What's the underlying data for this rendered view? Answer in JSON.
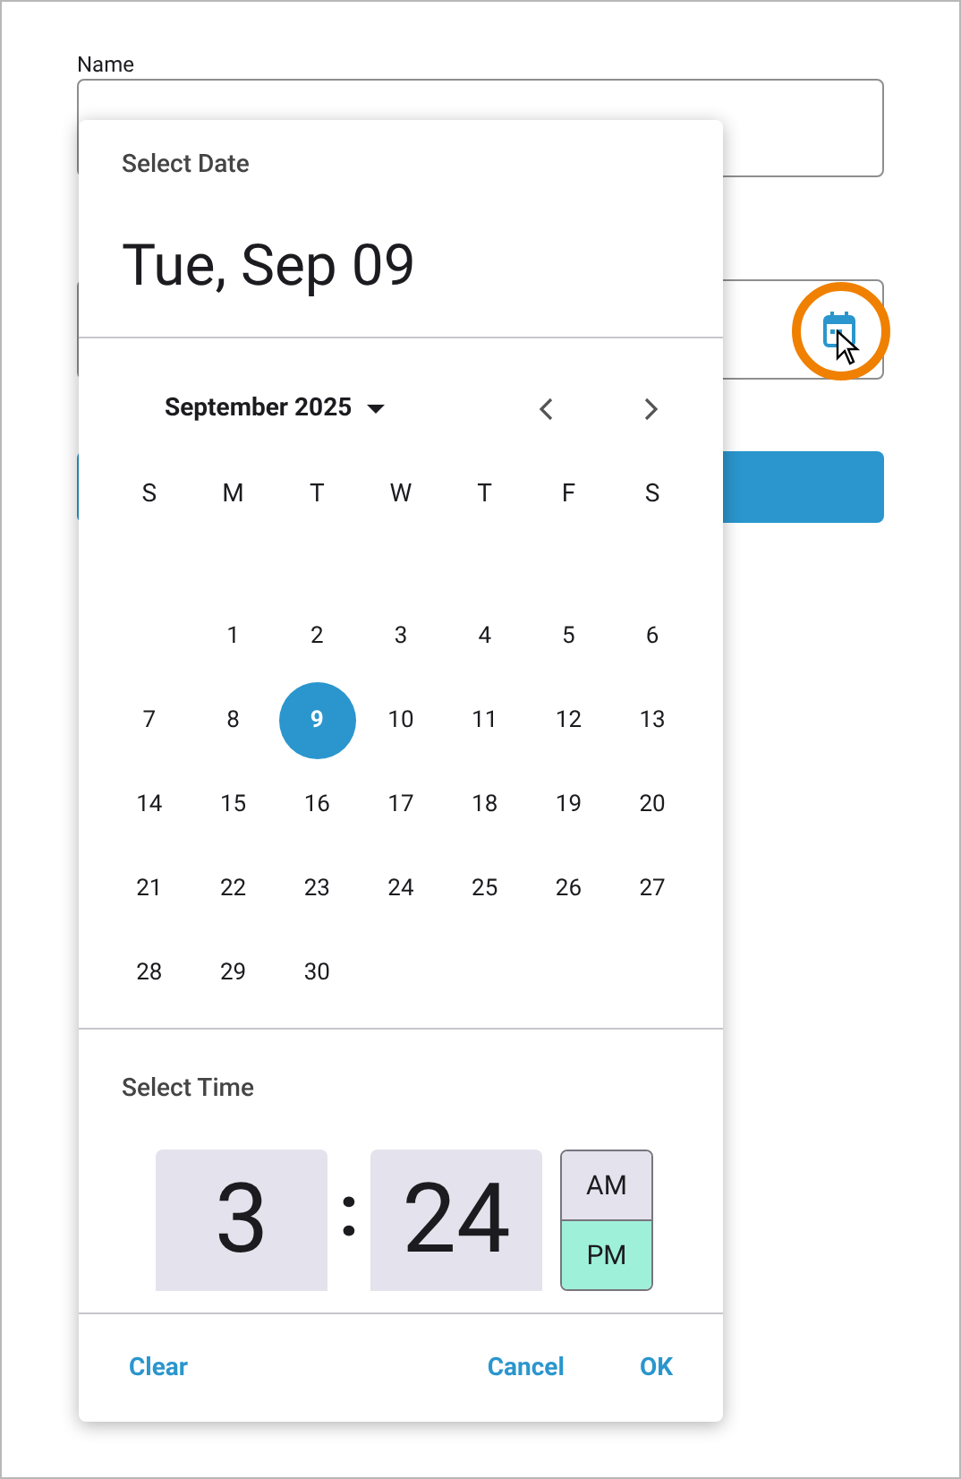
{
  "form": {
    "name_label": "Name",
    "submit_button": {
      "kind": "button"
    }
  },
  "date_picker": {
    "title": "Select Date",
    "selected_date": "Tue, Sep 09",
    "month_label": "September 2025",
    "weekdays": [
      "S",
      "M",
      "T",
      "W",
      "T",
      "F",
      "S"
    ],
    "weeks": [
      {
        "kind": "partial",
        "days": [
          {
            "day": "1",
            "selected": false
          },
          {
            "day": "2",
            "selected": false
          },
          {
            "day": "3",
            "selected": false
          },
          {
            "day": "4",
            "selected": false
          },
          {
            "day": "5",
            "selected": false
          },
          {
            "day": "6",
            "selected": false
          }
        ]
      },
      {
        "kind": "full",
        "days": [
          {
            "day": "7",
            "selected": false
          },
          {
            "day": "8",
            "selected": false
          },
          {
            "day": "9",
            "selected": true
          },
          {
            "day": "10",
            "selected": false
          },
          {
            "day": "11",
            "selected": false
          },
          {
            "day": "12",
            "selected": false
          },
          {
            "day": "13",
            "selected": false
          }
        ]
      },
      {
        "kind": "full",
        "days": [
          {
            "day": "14",
            "selected": false
          },
          {
            "day": "15",
            "selected": false
          },
          {
            "day": "16",
            "selected": false
          },
          {
            "day": "17",
            "selected": false
          },
          {
            "day": "18",
            "selected": false
          },
          {
            "day": "19",
            "selected": false
          },
          {
            "day": "20",
            "selected": false
          }
        ]
      },
      {
        "kind": "full",
        "days": [
          {
            "day": "21",
            "selected": false
          },
          {
            "day": "22",
            "selected": false
          },
          {
            "day": "23",
            "selected": false
          },
          {
            "day": "24",
            "selected": false
          },
          {
            "day": "25",
            "selected": false
          },
          {
            "day": "26",
            "selected": false
          },
          {
            "day": "27",
            "selected": false
          }
        ]
      },
      {
        "kind": "trailing",
        "days": [
          {
            "day": "28",
            "selected": false
          },
          {
            "day": "29",
            "selected": false
          },
          {
            "day": "30",
            "selected": false
          }
        ]
      }
    ],
    "time_title": "Select Time",
    "hour": "3",
    "separator": ":",
    "minute": "24",
    "periods": [
      {
        "label": "AM",
        "selected": false
      },
      {
        "label": "PM",
        "selected": true
      }
    ],
    "actions": [
      {
        "label": "Clear"
      },
      {
        "label": "Cancel"
      },
      {
        "label": "OK"
      }
    ]
  }
}
